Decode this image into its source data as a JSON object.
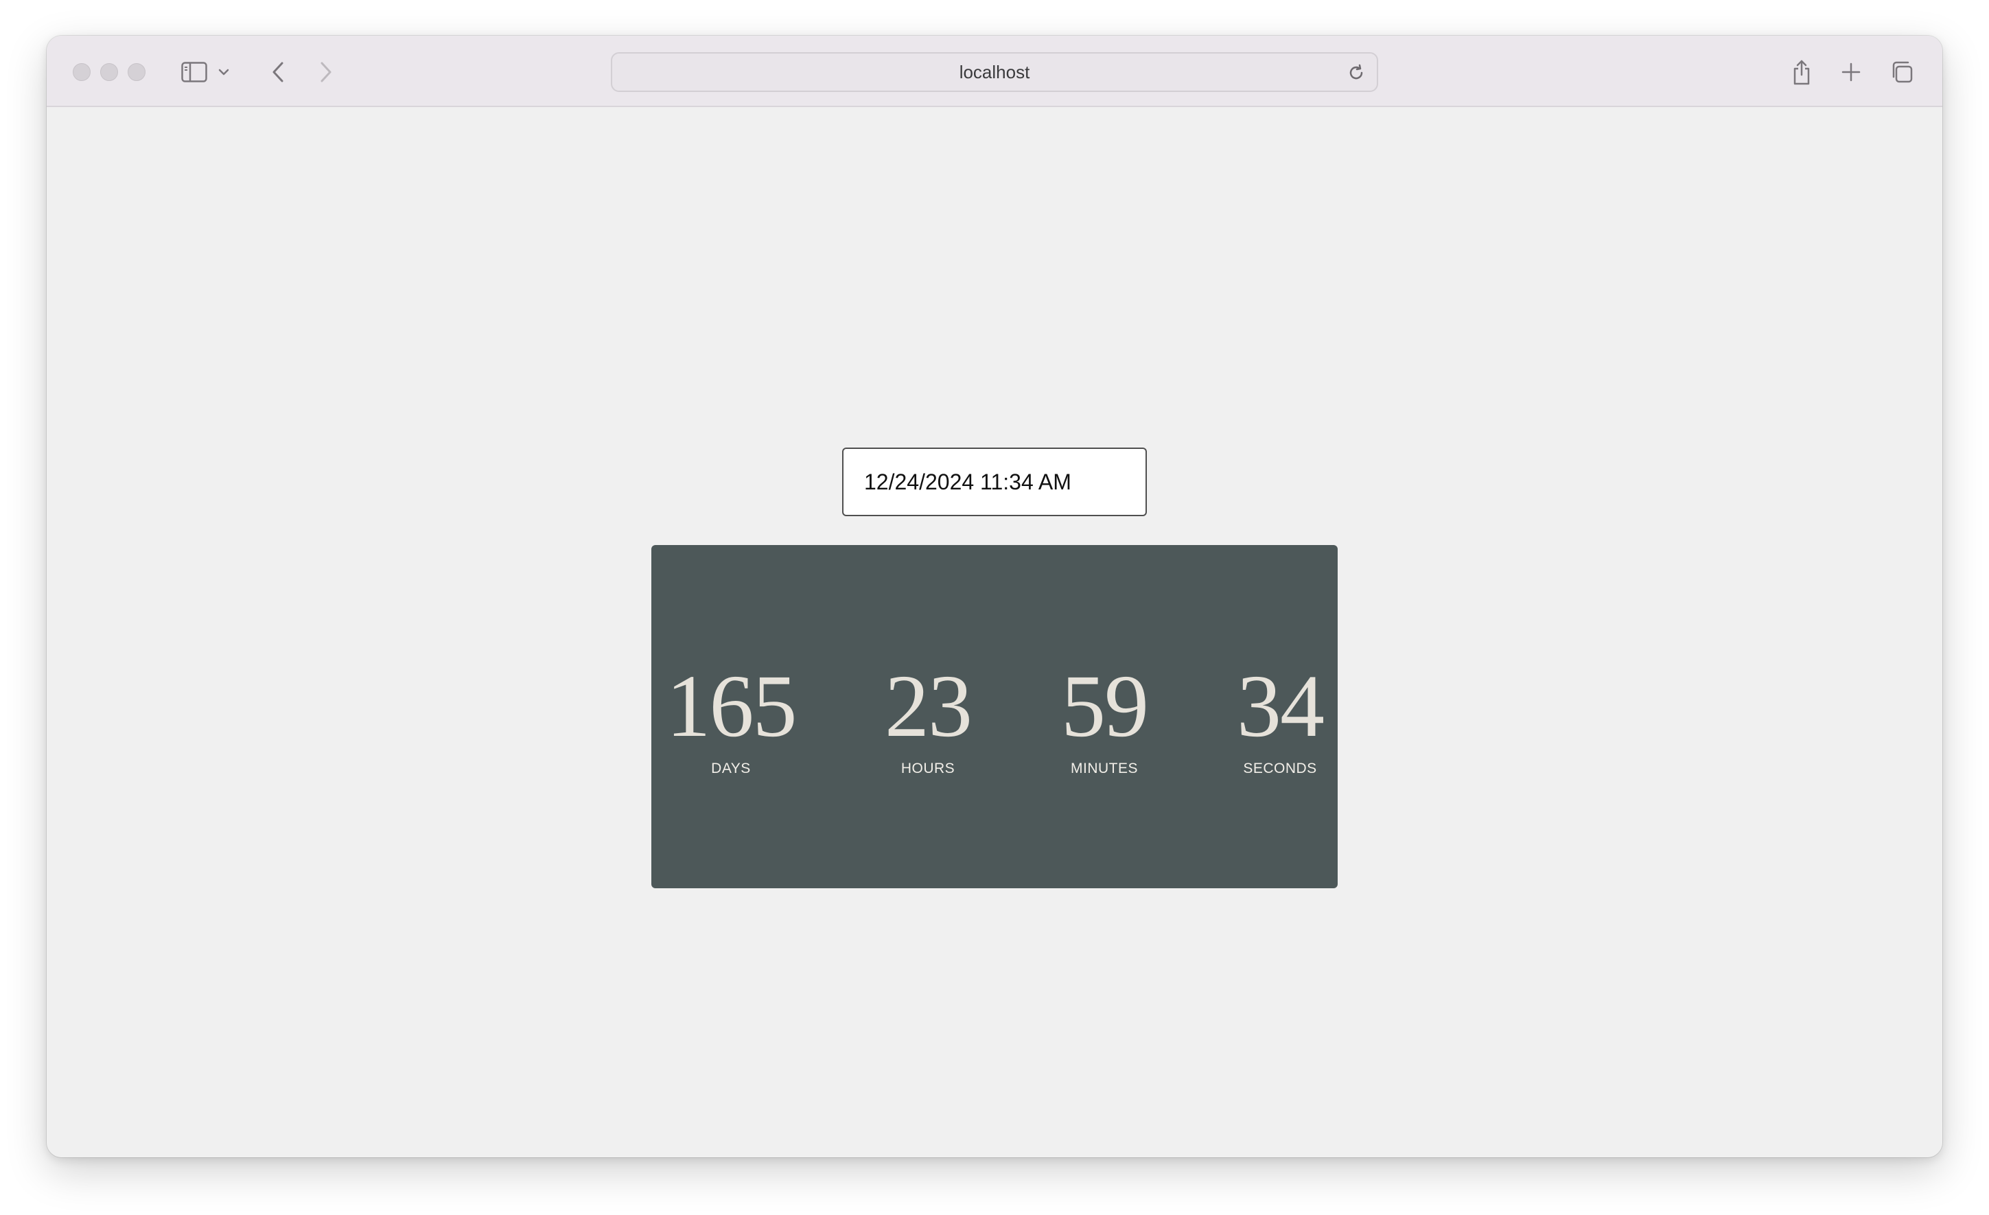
{
  "browser": {
    "address": "localhost",
    "icons": {
      "sidebar": "sidebar-icon",
      "chevron": "chevron-down-icon",
      "back": "back-arrow-icon",
      "forward": "forward-arrow-icon",
      "reload": "reload-icon",
      "share": "share-icon",
      "new_tab": "plus-icon",
      "tabs": "tab-overview-icon"
    }
  },
  "countdown": {
    "target_datetime": "12/24/2024 11:34 AM",
    "units": [
      {
        "value": "165",
        "label": "DAYS"
      },
      {
        "value": "23",
        "label": "HOURS"
      },
      {
        "value": "59",
        "label": "MINUTES"
      },
      {
        "value": "34",
        "label": "SECONDS"
      }
    ],
    "colors": {
      "panel": "#4d5859",
      "digits": "#e6e2da"
    }
  }
}
